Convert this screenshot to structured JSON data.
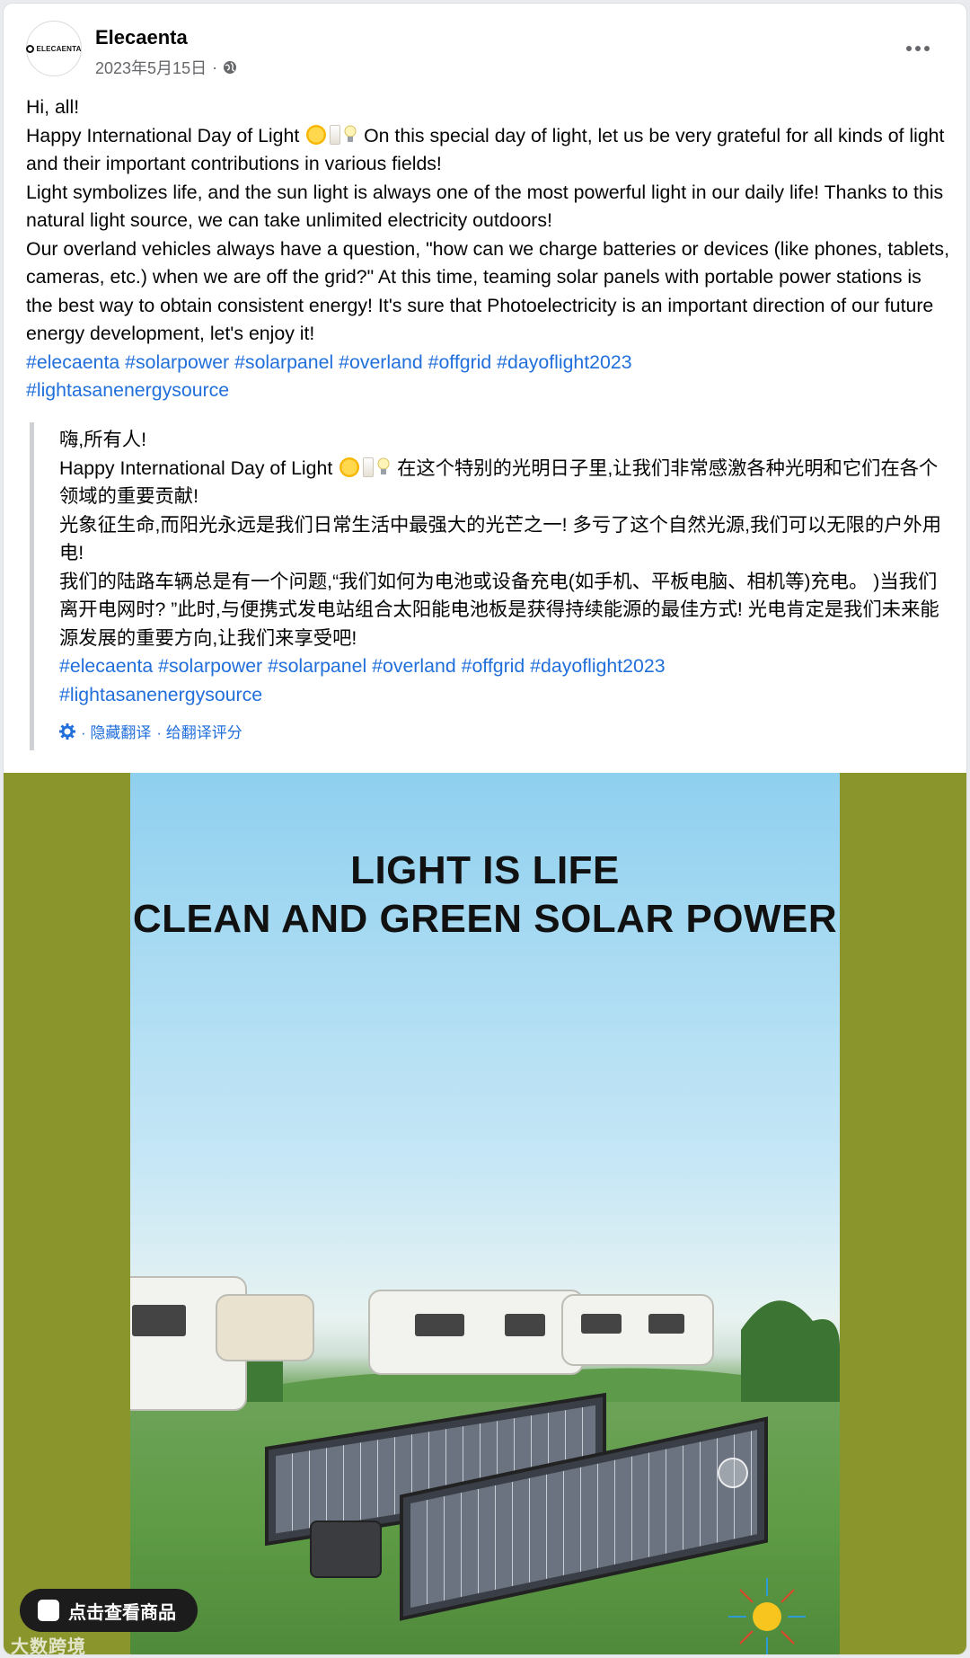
{
  "post": {
    "page_name": "Elecaenta",
    "avatar_text": "ELECAENTA",
    "date": "2023年5月15日",
    "separator": "·",
    "body": {
      "greeting": "Hi, all!",
      "line1_a": "Happy International Day of Light",
      "line1_b": "On this special day of light, let us be very grateful for all kinds of light and their important contributions in various fields!",
      "line2": "Light symbolizes life, and the sun light is always one of the most powerful light in our daily life! Thanks to this natural light source, we can take unlimited electricity outdoors!",
      "line3": "Our overland vehicles always have a question, \"how can we charge batteries or devices (like phones, tablets, cameras, etc.) when we are off the grid?\" At this time, teaming solar panels with portable power stations is the best way to obtain consistent energy! It's sure that Photoelectricity is an important direction of our future energy development, let's enjoy it!",
      "hashtags": [
        "#elecaenta",
        "#solarpower",
        "#solarpanel",
        "#overland",
        "#offgrid",
        "#dayoflight2023",
        "#lightasanenergysource"
      ]
    },
    "translation": {
      "greeting": "嗨,所有人!",
      "line1_a": "Happy International Day of Light",
      "line1_b": "在这个特别的光明日子里,让我们非常感激各种光明和它们在各个领域的重要贡献!",
      "line2": "光象征生命,而阳光永远是我们日常生活中最强大的光芒之一! 多亏了这个自然光源,我们可以无限的户外用电!",
      "line3": "我们的陆路车辆总是有一个问题,“我们如何为电池或设备充电(如手机、平板电脑、相机等)充电。 )当我们离开电网时? ”此时,与便携式发电站组合太阳能电池板是获得持续能源的最佳方式! 光电肯定是我们未来能源发展的重要方向,让我们来享受吧!",
      "hashtags": [
        "#elecaenta",
        "#solarpower",
        "#solarpanel",
        "#overland",
        "#offgrid",
        "#dayoflight2023",
        "#lightasanenergysource"
      ],
      "hide_translation": "· 隐藏翻译",
      "rate_translation": "· 给翻译评分"
    },
    "media": {
      "headline_1": "LIGHT IS LIFE",
      "headline_2": "CLEAN AND GREEN SOLAR POWER",
      "shop_button": "点击查看商品",
      "watermark": "大数跨境",
      "bg_color": "#8a962b"
    }
  },
  "colors": {
    "link": "#216fdb",
    "meta": "#65676b",
    "text": "#050505"
  },
  "icons": [
    "globe-icon",
    "more-icon",
    "gear-icon",
    "sun-emoji",
    "candle-emoji",
    "bulb-emoji",
    "shop-bag-icon"
  ]
}
